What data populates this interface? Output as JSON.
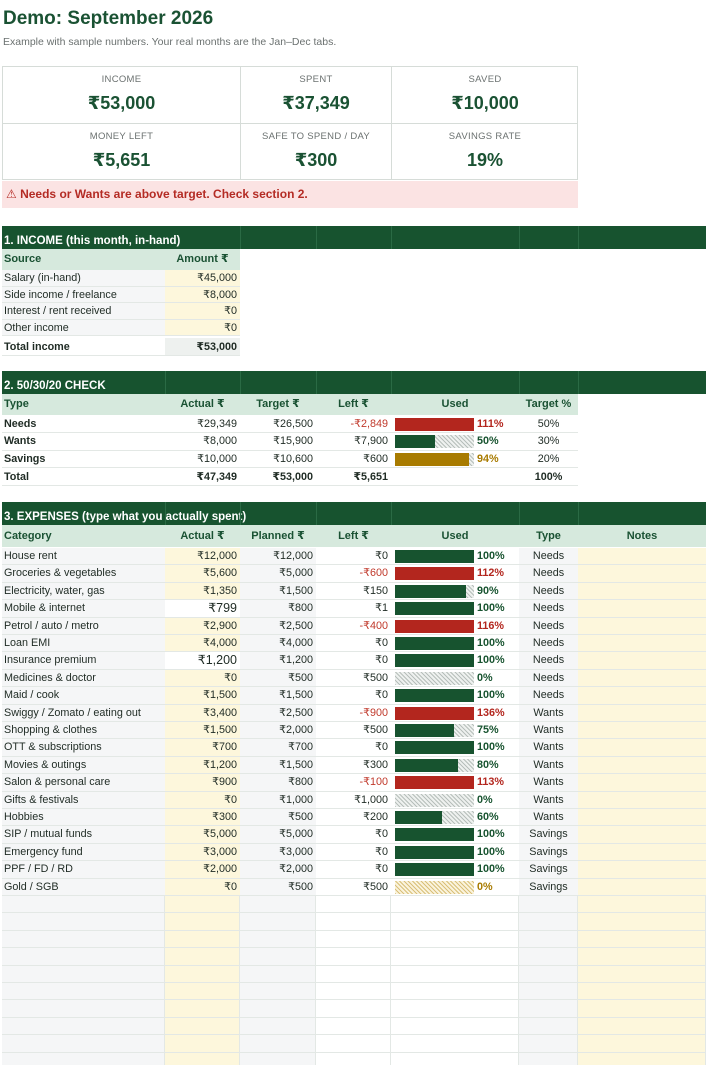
{
  "title": "Demo: September 2026",
  "subtitle": "Example with sample numbers. Your real months are the Jan–Dec tabs.",
  "kpis": [
    {
      "label": "INCOME",
      "value": "₹53,000"
    },
    {
      "label": "SPENT",
      "value": "₹37,349"
    },
    {
      "label": "SAVED",
      "value": "₹10,000"
    },
    {
      "label": "MONEY LEFT",
      "value": "₹5,651"
    },
    {
      "label": "SAFE TO SPEND / DAY",
      "value": "₹300"
    },
    {
      "label": "SAVINGS RATE",
      "value": "19%"
    }
  ],
  "alert": "⚠ Needs or Wants are above target. Check section 2.",
  "colors": {
    "dark_green": "#17532f",
    "red": "#b3261e",
    "gold": "#a87b00",
    "header_bg": "#d6e9dd",
    "cream": "#fdf7dc"
  },
  "income": {
    "section_title": "1. INCOME (this month, in-hand)",
    "headers": [
      "Source",
      "Amount ₹"
    ],
    "rows": [
      {
        "source": "Salary (in-hand)",
        "amount": "₹45,000"
      },
      {
        "source": "Side income / freelance",
        "amount": "₹8,000"
      },
      {
        "source": "Interest / rent received",
        "amount": "₹0"
      },
      {
        "source": "Other income",
        "amount": "₹0"
      }
    ],
    "total_label": "Total income",
    "total_value": "₹53,000"
  },
  "check": {
    "section_title": "2. 50/30/20 CHECK",
    "headers": [
      "Type",
      "Actual ₹",
      "Target ₹",
      "Left ₹",
      "Used",
      "Target %"
    ],
    "rows": [
      {
        "type": "Needs",
        "actual": "₹29,349",
        "target": "₹26,500",
        "left": "-₹2,849",
        "used": "111%",
        "used_pct": 111,
        "target_pct": "50%",
        "color": "red"
      },
      {
        "type": "Wants",
        "actual": "₹8,000",
        "target": "₹15,900",
        "left": "₹7,900",
        "used": "50%",
        "used_pct": 50,
        "target_pct": "30%",
        "color": "green"
      },
      {
        "type": "Savings",
        "actual": "₹10,000",
        "target": "₹10,600",
        "left": "₹600",
        "used": "94%",
        "used_pct": 94,
        "target_pct": "20%",
        "color": "gold"
      }
    ],
    "total": {
      "label": "Total",
      "actual": "₹47,349",
      "target": "₹53,000",
      "left": "₹5,651",
      "target_pct": "100%"
    }
  },
  "expenses": {
    "section_title": "3. EXPENSES (type what you actually spent)",
    "headers": [
      "Category",
      "Actual ₹",
      "Planned ₹",
      "Left ₹",
      "Used",
      "Type",
      "Notes"
    ],
    "rows": [
      {
        "category": "House rent",
        "actual": "₹12,000",
        "planned": "₹12,000",
        "left": "₹0",
        "used": "100%",
        "used_pct": 100,
        "type": "Needs"
      },
      {
        "category": "Groceries & vegetables",
        "actual": "₹5,600",
        "planned": "₹5,000",
        "left": "-₹600",
        "used": "112%",
        "used_pct": 112,
        "type": "Needs"
      },
      {
        "category": "Electricity, water, gas",
        "actual": "₹1,350",
        "planned": "₹1,500",
        "left": "₹150",
        "used": "90%",
        "used_pct": 90,
        "type": "Needs"
      },
      {
        "category": "Mobile & internet",
        "actual": "₹799",
        "planned": "₹800",
        "left": "₹1",
        "used": "100%",
        "used_pct": 100,
        "type": "Needs",
        "actual_style": "white"
      },
      {
        "category": "Petrol / auto / metro",
        "actual": "₹2,900",
        "planned": "₹2,500",
        "left": "-₹400",
        "used": "116%",
        "used_pct": 116,
        "type": "Needs"
      },
      {
        "category": "Loan EMI",
        "actual": "₹4,000",
        "planned": "₹4,000",
        "left": "₹0",
        "used": "100%",
        "used_pct": 100,
        "type": "Needs"
      },
      {
        "category": "Insurance premium",
        "actual": "₹1,200",
        "planned": "₹1,200",
        "left": "₹0",
        "used": "100%",
        "used_pct": 100,
        "type": "Needs",
        "actual_style": "white"
      },
      {
        "category": "Medicines & doctor",
        "actual": "₹0",
        "planned": "₹500",
        "left": "₹500",
        "used": "0%",
        "used_pct": 0,
        "type": "Needs"
      },
      {
        "category": "Maid / cook",
        "actual": "₹1,500",
        "planned": "₹1,500",
        "left": "₹0",
        "used": "100%",
        "used_pct": 100,
        "type": "Needs"
      },
      {
        "category": "Swiggy / Zomato / eating out",
        "actual": "₹3,400",
        "planned": "₹2,500",
        "left": "-₹900",
        "used": "136%",
        "used_pct": 136,
        "type": "Wants"
      },
      {
        "category": "Shopping & clothes",
        "actual": "₹1,500",
        "planned": "₹2,000",
        "left": "₹500",
        "used": "75%",
        "used_pct": 75,
        "type": "Wants"
      },
      {
        "category": "OTT & subscriptions",
        "actual": "₹700",
        "planned": "₹700",
        "left": "₹0",
        "used": "100%",
        "used_pct": 100,
        "type": "Wants"
      },
      {
        "category": "Movies & outings",
        "actual": "₹1,200",
        "planned": "₹1,500",
        "left": "₹300",
        "used": "80%",
        "used_pct": 80,
        "type": "Wants"
      },
      {
        "category": "Salon & personal care",
        "actual": "₹900",
        "planned": "₹800",
        "left": "-₹100",
        "used": "113%",
        "used_pct": 113,
        "type": "Wants"
      },
      {
        "category": "Gifts & festivals",
        "actual": "₹0",
        "planned": "₹1,000",
        "left": "₹1,000",
        "used": "0%",
        "used_pct": 0,
        "type": "Wants"
      },
      {
        "category": "Hobbies",
        "actual": "₹300",
        "planned": "₹500",
        "left": "₹200",
        "used": "60%",
        "used_pct": 60,
        "type": "Wants"
      },
      {
        "category": "SIP / mutual funds",
        "actual": "₹5,000",
        "planned": "₹5,000",
        "left": "₹0",
        "used": "100%",
        "used_pct": 100,
        "type": "Savings"
      },
      {
        "category": "Emergency fund",
        "actual": "₹3,000",
        "planned": "₹3,000",
        "left": "₹0",
        "used": "100%",
        "used_pct": 100,
        "type": "Savings"
      },
      {
        "category": "PPF / FD / RD",
        "actual": "₹2,000",
        "planned": "₹2,000",
        "left": "₹0",
        "used": "100%",
        "used_pct": 100,
        "type": "Savings"
      },
      {
        "category": "Gold / SGB",
        "actual": "₹0",
        "planned": "₹500",
        "left": "₹500",
        "used": "0%",
        "used_pct": 0,
        "type": "Savings",
        "bar_style": "gold"
      }
    ]
  }
}
